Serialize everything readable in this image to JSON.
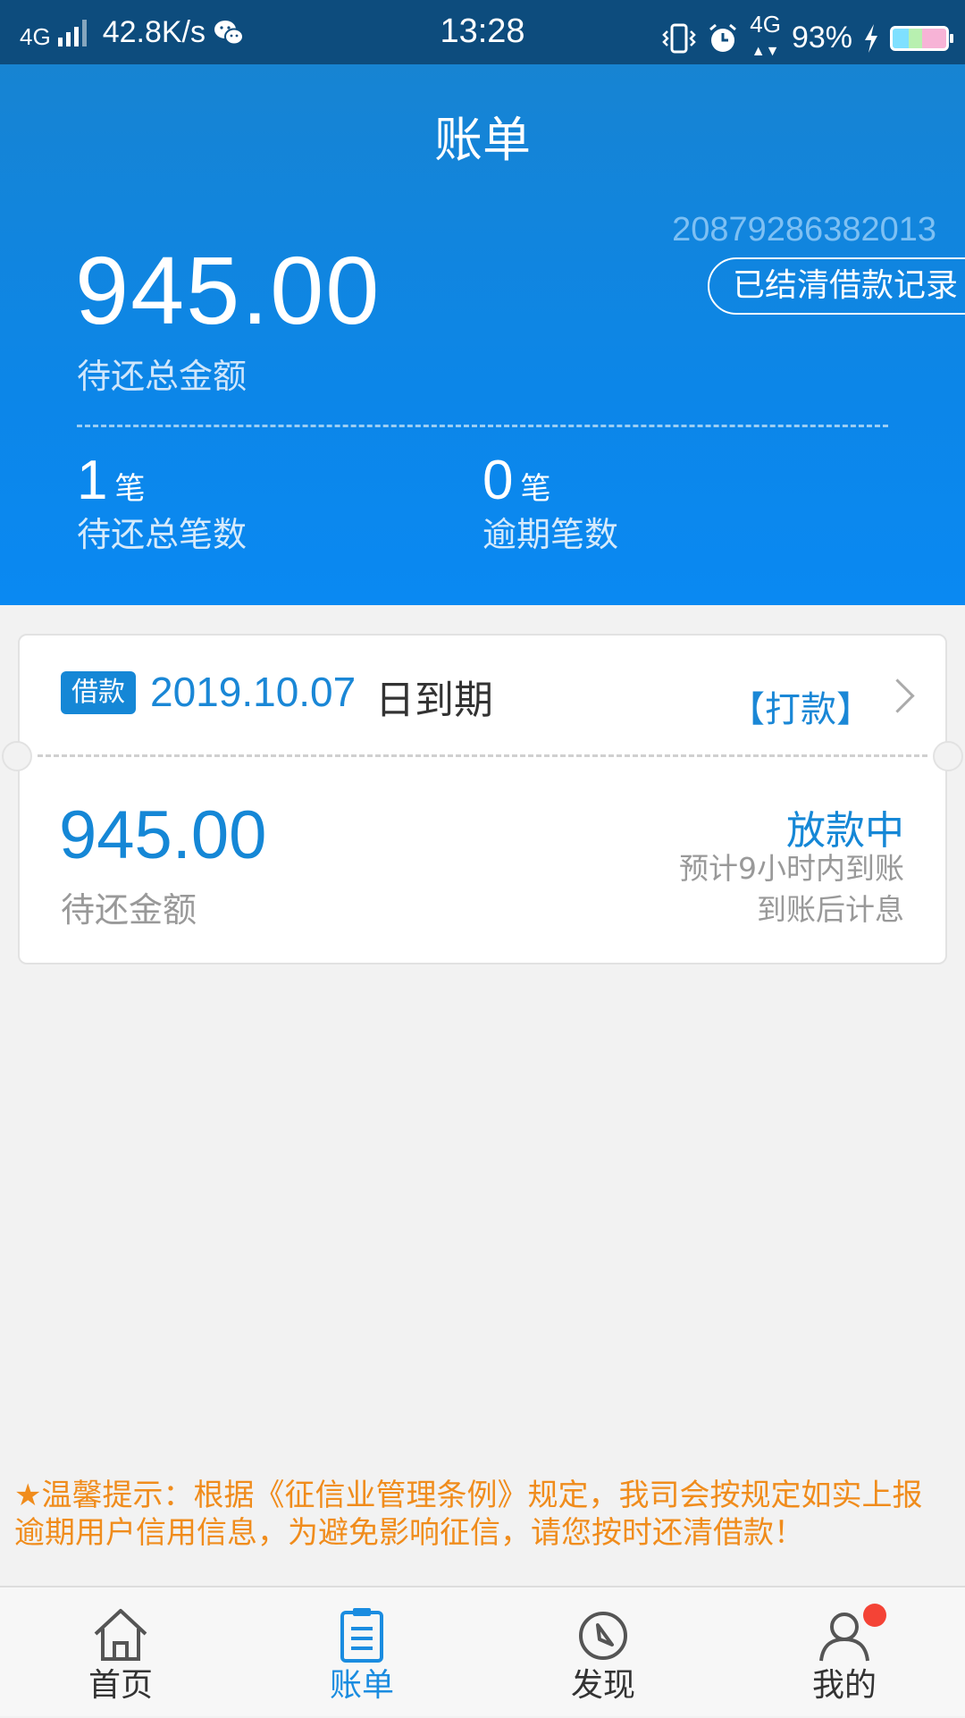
{
  "status_bar": {
    "network_left": "4G",
    "speed": "42.8K/s",
    "time": "13:28",
    "network_right": "4G",
    "battery": "93%"
  },
  "header": {
    "title": "账单",
    "account_number": "20879286382013",
    "settled_button": "已结清借款记录",
    "total_amount": "945.00",
    "total_label": "待还总金额",
    "pending_count": "1",
    "pending_unit": "笔",
    "pending_label": "待还总笔数",
    "overdue_count": "0",
    "overdue_unit": "笔",
    "overdue_label": "逾期笔数"
  },
  "loan_card": {
    "tag": "借款",
    "due_date": "2019.10.07",
    "due_suffix": "日到期",
    "action": "【打款】",
    "amount": "945.00",
    "amount_label": "待还金额",
    "status": "放款中",
    "note_1": "预计9小时内到账",
    "note_2": "到账后计息"
  },
  "tip": "★温馨提示：根据《征信业管理条例》规定，我司会按规定如实上报逾期用户信用信息，为避免影响征信，请您按时还清借款！",
  "tabs": [
    {
      "label": "首页",
      "icon": "home-icon",
      "active": false
    },
    {
      "label": "账单",
      "icon": "bill-icon",
      "active": true
    },
    {
      "label": "发现",
      "icon": "compass-icon",
      "active": false
    },
    {
      "label": "我的",
      "icon": "profile-icon",
      "active": false
    }
  ],
  "colors": {
    "header_blue": "#0c86e8",
    "accent_blue": "#1587d6",
    "tip_orange": "#f08c1c",
    "badge_red": "#f44336"
  }
}
